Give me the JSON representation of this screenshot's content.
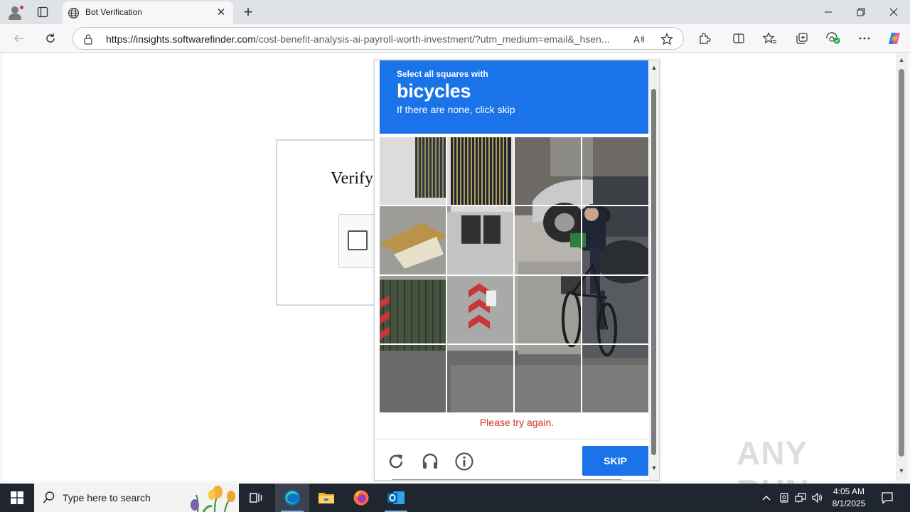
{
  "browser": {
    "tab_title": "Bot Verification",
    "url_domain": "https://insights.softwarefinder.com",
    "url_path": "/cost-benefit-analysis-ai-payroll-worth-investment/?utm_medium=email&_hsen..."
  },
  "page": {
    "verify_title": "Verify"
  },
  "challenge": {
    "prompt": "Select all squares with",
    "target": "bicycles",
    "hint": "If there are none, click skip",
    "error": "Please try again.",
    "skip_label": "SKIP",
    "grid_rows": 4,
    "grid_cols": 4,
    "header_color": "#1a73e8",
    "error_color": "#d93025"
  },
  "taskbar": {
    "search_placeholder": "Type here to search",
    "time": "4:05 AM",
    "date": "8/1/2025"
  },
  "watermark": {
    "text": "ANY RUN"
  },
  "icons": {
    "browser": [
      "profile-icon",
      "tab-actions-icon",
      "globe-icon",
      "close-icon",
      "plus-icon",
      "minimize-icon",
      "restore-icon",
      "back-icon",
      "refresh-icon",
      "lock-icon",
      "read-aloud-icon",
      "star-icon",
      "extensions-icon",
      "split-screen-icon",
      "favorites-icon",
      "collections-icon",
      "performance-icon",
      "more-icon",
      "copilot-icon"
    ],
    "challenge": [
      "reload-icon",
      "headphones-icon",
      "info-icon"
    ],
    "taskbar": [
      "windows-icon",
      "search-icon",
      "task-view-icon",
      "edge-icon",
      "file-explorer-icon",
      "firefox-icon",
      "outlook-icon",
      "chevron-up-icon",
      "meet-icon",
      "network-icon",
      "volume-icon",
      "notification-icon"
    ]
  }
}
